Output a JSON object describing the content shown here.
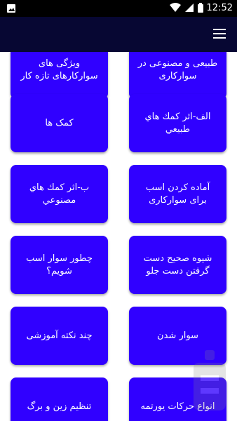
{
  "status_bar": {
    "time": "12:52",
    "icons": [
      "image-icon",
      "wifi-icon",
      "signal-icon",
      "battery-icon"
    ]
  },
  "app_bar": {
    "menu_icon": "hamburger-menu-icon"
  },
  "grid": {
    "items": [
      {
        "label": "طبیعی و مصنوعی در سوارکاری"
      },
      {
        "label": "ویژگی های سوارکارهای تازه کار"
      },
      {
        "label": "الف-اثر كمك هاي طبيعي"
      },
      {
        "label": "کمک ها"
      },
      {
        "label": "آماده کردن اسب برای سوارکاری"
      },
      {
        "label": "ب-اثر كمك هاي مصنوعي"
      },
      {
        "label": "شیوه صحیح دست گرفتن دست جلو"
      },
      {
        "label": "چطور سوار اسب شویم؟"
      },
      {
        "label": "سوار شدن"
      },
      {
        "label": "چند نکته آموزشی"
      },
      {
        "label": "انواع حرکات یورتمه"
      },
      {
        "label": "تنظیم زین و برگ"
      }
    ]
  },
  "colors": {
    "card": "#3000ff",
    "app_bar": "#070733",
    "status_bar": "#000000"
  }
}
